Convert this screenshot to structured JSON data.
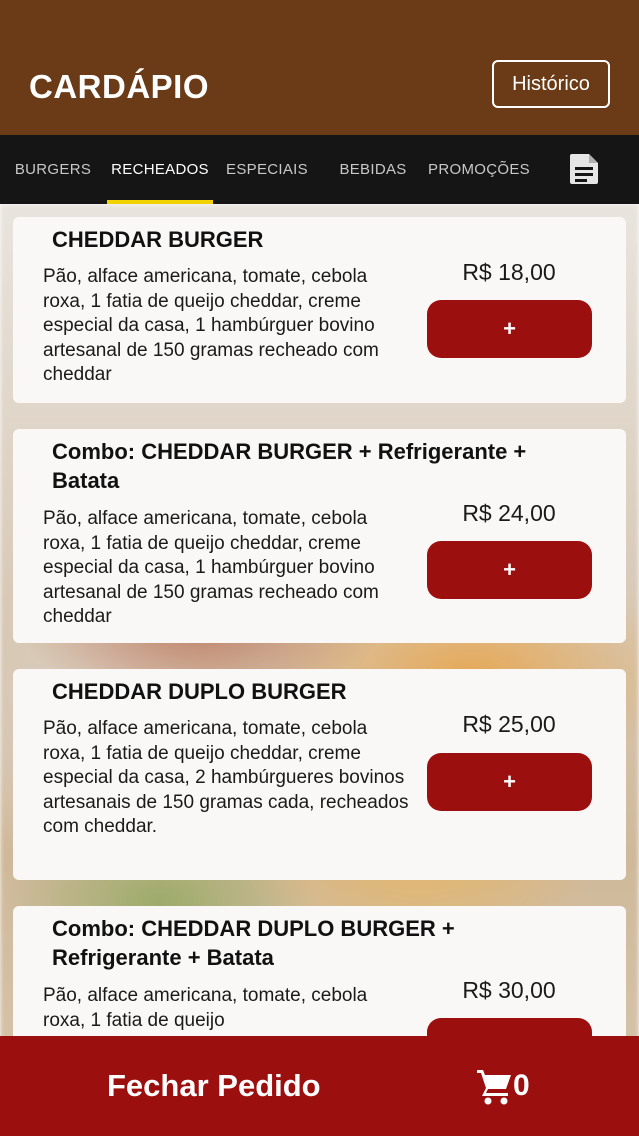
{
  "header": {
    "title": "CARDÁPIO",
    "history_label": "Histórico"
  },
  "tabs": [
    {
      "label": "BURGERS"
    },
    {
      "label": "RECHEADOS"
    },
    {
      "label": "ESPECIAIS"
    },
    {
      "label": "BEBIDAS"
    },
    {
      "label": "PROMOÇÕES"
    }
  ],
  "active_tab": "RECHEADOS",
  "items": [
    {
      "title": "CHEDDAR BURGER",
      "description": "Pão, alface americana, tomate, cebola roxa, 1 fatia de queijo cheddar, creme especial da casa, 1 hambúrguer bovino artesanal de 150 gramas recheado com cheddar",
      "price": "R$ 18,00",
      "add_label": "+"
    },
    {
      "title": "Combo: CHEDDAR BURGER + Refrigerante + Batata",
      "description": "Pão, alface americana, tomate, cebola roxa, 1 fatia de queijo cheddar, creme especial da casa, 1 hambúrguer bovino artesanal de 150 gramas recheado com cheddar",
      "price": "R$ 24,00",
      "add_label": "+"
    },
    {
      "title": "CHEDDAR DUPLO BURGER",
      "description": "Pão, alface americana, tomate, cebola roxa, 1 fatia de queijo cheddar, creme especial da casa, 2 hambúrgueres bovinos artesanais de 150 gramas cada, recheados com cheddar.",
      "price": "R$ 25,00",
      "add_label": "+"
    },
    {
      "title": "Combo: CHEDDAR DUPLO BURGER + Refrigerante + Batata",
      "description": "Pão, alface americana, tomate, cebola roxa, 1 fatia de queijo",
      "price": "R$ 30,00",
      "add_label": "+"
    }
  ],
  "footer": {
    "label": "Fechar Pedido",
    "cart_count": "0"
  },
  "colors": {
    "header_bg": "#6b3a16",
    "tabs_bg": "#151515",
    "tab_indicator": "#f2d100",
    "accent_red": "#9c0f0f"
  },
  "icons": {
    "tab_bar_right": "document-icon",
    "footer_cart": "cart-icon"
  }
}
